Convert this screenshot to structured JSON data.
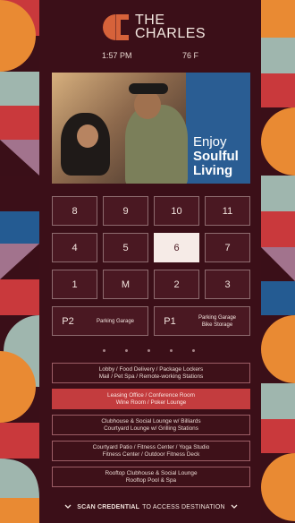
{
  "header": {
    "brand_line1": "THE",
    "brand_line2": "CHARLES",
    "time": "1:57 PM",
    "temperature": "76 F"
  },
  "hero": {
    "line1": "Enjoy",
    "line2": "Soulful",
    "line3": "Living"
  },
  "floors": {
    "row1": [
      "8",
      "9",
      "10",
      "11"
    ],
    "row2": [
      "4",
      "5",
      "6",
      "7"
    ],
    "row3": [
      "1",
      "M",
      "2",
      "3"
    ],
    "selected": "6",
    "p2": {
      "label": "P2",
      "desc": "Parking Garage"
    },
    "p1": {
      "label": "P1",
      "desc_line1": "Parking Garage",
      "desc_line2": "Bike Storage"
    }
  },
  "destinations": [
    {
      "line1": "Lobby / Food Delivery / Package Lockers",
      "line2": "Mail / Pet Spa / Remote-working Stations",
      "active": false
    },
    {
      "line1": "Leasing Office / Conference Room",
      "line2": "Wine Room / Poker Lounge",
      "active": true
    },
    {
      "line1": "Clubhouse & Social Lounge w/ Billiards",
      "line2": "Courtyard Lounge w/ Grilling Stations",
      "active": false
    },
    {
      "line1": "Courtyard Patio / Fitness Center / Yoga Studio",
      "line2": "Fitness Center / Outdoor Fitness Deck",
      "active": false
    },
    {
      "line1": "Rooftop Clubhouse & Social Lounge",
      "line2": "Rooftop Pool & Spa",
      "active": false
    }
  ],
  "footer": {
    "bold": "SCAN CREDENTIAL",
    "rest": "TO ACCESS DESTINATION"
  },
  "colors": {
    "background": "#3b0f18",
    "accent_red": "#c33c3e",
    "orange": "#e07a2e",
    "blue": "#245b92",
    "sage": "#9fb6ae",
    "mauve": "#a2738d",
    "cream": "#f3e0cf",
    "hero_blue": "#2a5d93"
  }
}
